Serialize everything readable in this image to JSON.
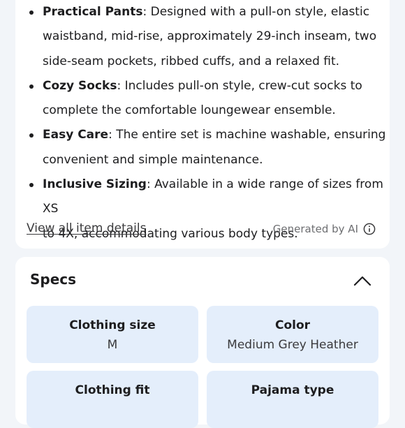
{
  "features": [
    {
      "name": "Practical Pants",
      "text": ": Designed with a pull-on style, elastic",
      "lines": [
        "waistband, mid-rise, approximately 29-inch inseam, two",
        "side-seam pockets, ribbed cuffs, and a relaxed fit."
      ]
    },
    {
      "name": "Cozy Socks",
      "text": ": Includes pull-on style, crew-cut socks to",
      "lines": [
        "complete the comfortable loungewear ensemble."
      ]
    },
    {
      "name": "Easy Care",
      "text": ": The entire set is machine washable, ensuring",
      "lines": [
        "convenient and simple maintenance."
      ]
    },
    {
      "name": "Inclusive Sizing",
      "text": ": Available in a wide range of sizes from XS",
      "lines": [
        "to 4X, accommodating various body types."
      ]
    }
  ],
  "view_all_label": "View all item details",
  "generated_by": "Generated by AI",
  "specs": {
    "title": "Specs",
    "items": [
      {
        "label": "Clothing size",
        "value": "M"
      },
      {
        "label": "Color",
        "value": "Medium Grey Heather"
      },
      {
        "label": "Clothing fit",
        "value": ""
      },
      {
        "label": "Pajama type",
        "value": ""
      }
    ]
  },
  "icons": {
    "info": "info-circle-icon",
    "collapse": "chevron-up-icon"
  }
}
